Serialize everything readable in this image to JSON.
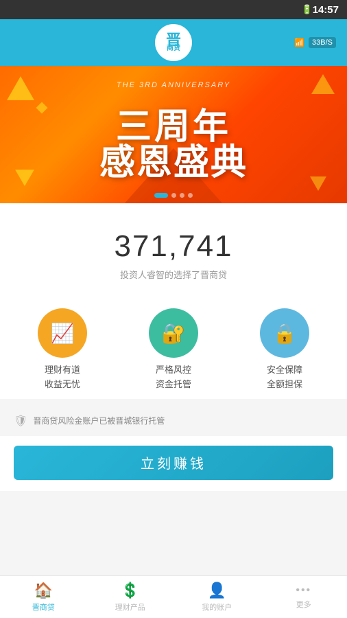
{
  "statusBar": {
    "time": "14:57",
    "battery": "🔋",
    "wifi": "WiFi",
    "speed": "33B/S"
  },
  "header": {
    "logo": "晋",
    "logoSubtext": "商贷"
  },
  "banner": {
    "subtitleText": "THE 3RD ANNIVERSARY",
    "line1": "三周年",
    "line2": "感恩盛典",
    "dots": [
      true,
      false,
      false,
      false
    ],
    "activeDot": 0
  },
  "stats": {
    "number": "371,741",
    "description": "投资人睿智的选择了晋商贷"
  },
  "features": [
    {
      "iconChar": "📊",
      "line1": "理财有道",
      "line2": "收益无忧"
    },
    {
      "iconChar": "🔐",
      "line1": "严格风控",
      "line2": "资金托管"
    },
    {
      "iconChar": "🔒",
      "line1": "安全保障",
      "line2": "全额担保"
    }
  ],
  "trustBanner": {
    "text": "晋商贷风险金账户已被晋城银行托管"
  },
  "ctaButton": {
    "label": "立刻赚钱"
  },
  "bottomNav": [
    {
      "label": "晋商贷",
      "icon": "🏠",
      "active": true
    },
    {
      "label": "理财产品",
      "icon": "💲",
      "active": false
    },
    {
      "label": "我的账户",
      "icon": "👤",
      "active": false
    },
    {
      "label": "更多",
      "icon": "•••",
      "active": false
    }
  ]
}
